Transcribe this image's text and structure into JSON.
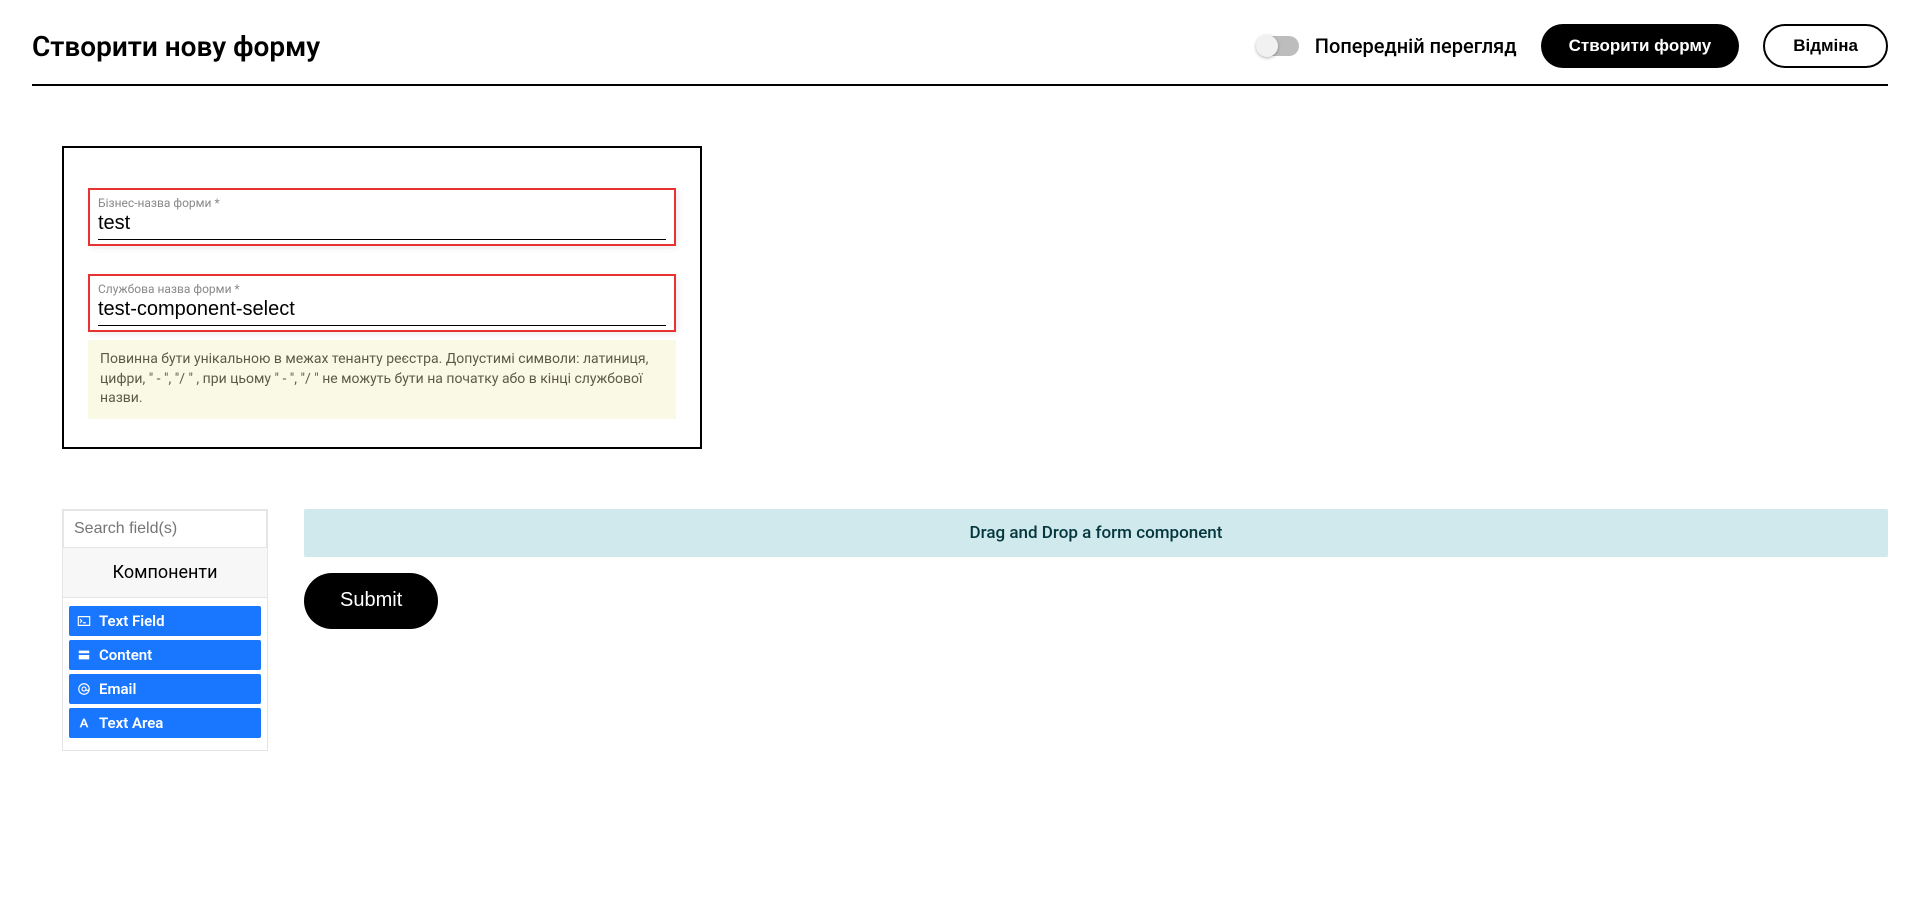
{
  "header": {
    "title": "Створити нову форму",
    "preview_label": "Попередній перегляд",
    "create_label": "Створити форму",
    "cancel_label": "Відміна"
  },
  "form": {
    "business_name": {
      "label": "Бізнес-назва форми *",
      "value": "test"
    },
    "service_name": {
      "label": "Службова назва форми *",
      "value": "test-component-select",
      "helper": "Повинна бути унікальною в межах тенанту реєстра. Допустимі символи: латиниця, цифри, \" - \", \"/ \" , при цьому  \" - \", \"/ \" не можуть бути на початку або в кінці службової назви."
    }
  },
  "builder": {
    "search_placeholder": "Search field(s)",
    "components_header": "Компоненти",
    "components": [
      {
        "icon": "terminal",
        "label": "Text Field"
      },
      {
        "icon": "card",
        "label": "Content"
      },
      {
        "icon": "at",
        "label": "Email"
      },
      {
        "icon": "font",
        "label": "Text Area"
      }
    ],
    "drop_text": "Drag and Drop a form component",
    "submit_label": "Submit"
  }
}
